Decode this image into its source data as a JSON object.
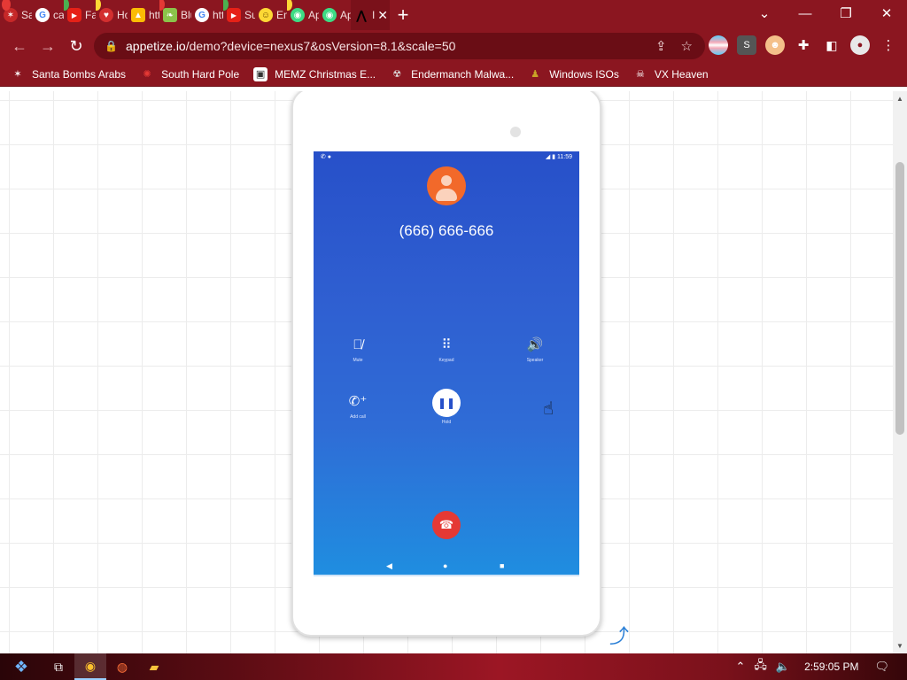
{
  "browser": {
    "tabs": [
      {
        "label": "San",
        "icon": "santa-icon"
      },
      {
        "label": "calc",
        "icon": "google-icon"
      },
      {
        "label": "Fam",
        "icon": "youtube-icon"
      },
      {
        "label": "Hor",
        "icon": "heart-icon"
      },
      {
        "label": "http",
        "icon": "drive-icon"
      },
      {
        "label": "Blue",
        "icon": "leaf-icon"
      },
      {
        "label": "http",
        "icon": "google-icon"
      },
      {
        "label": "Surf",
        "icon": "youtube-icon"
      },
      {
        "label": "Emo",
        "icon": "smiley-icon"
      },
      {
        "label": "Apk",
        "icon": "android-icon"
      },
      {
        "label": "Apk",
        "icon": "android-icon"
      },
      {
        "label": "I",
        "icon": "appetize-icon"
      }
    ],
    "url_host": "appetize.io",
    "url_path": "/demo?device=nexus7&osVersion=8.1&scale=50",
    "bookmarks": [
      {
        "label": "Santa Bombs Arabs",
        "icon": "santa-icon"
      },
      {
        "label": "South Hard Pole",
        "icon": "gear-icon"
      },
      {
        "label": "MEMZ Christmas E...",
        "icon": "window-icon"
      },
      {
        "label": "Endermanch Malwa...",
        "icon": "raccoon-icon"
      },
      {
        "label": "Windows ISOs",
        "icon": "folder-icon"
      },
      {
        "label": "VX Heaven",
        "icon": "skull-icon"
      }
    ],
    "extension_letter": "S"
  },
  "phone": {
    "status_time": "11:59",
    "number": "(666) 666-666",
    "buttons": {
      "mute": "Mute",
      "keypad": "Keypad",
      "speaker": "Speaker",
      "add_call": "Add call",
      "hold": "Hold"
    }
  },
  "taskbar": {
    "time": "2:59:05 PM"
  }
}
